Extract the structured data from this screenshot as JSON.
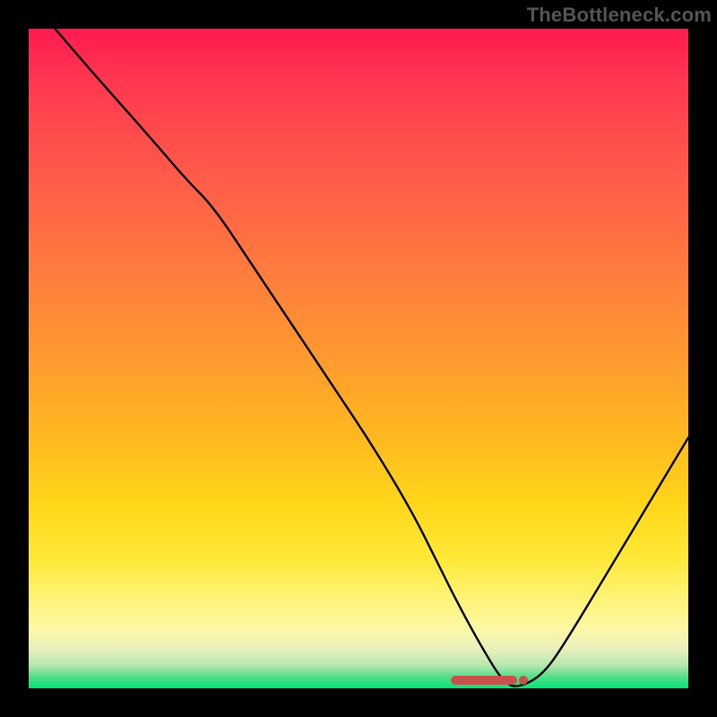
{
  "watermark": "TheBottleneck.com",
  "chart_data": {
    "type": "line",
    "title": "",
    "xlabel": "",
    "ylabel": "",
    "xlim": [
      0,
      100
    ],
    "ylim": [
      0,
      100
    ],
    "grid": false,
    "legend": false,
    "series": [
      {
        "name": "bottleneck-curve",
        "x": [
          4,
          10,
          18,
          24,
          28,
          34,
          40,
          46,
          52,
          58,
          62,
          66,
          70,
          72,
          74,
          78,
          82,
          88,
          94,
          100
        ],
        "values": [
          100,
          93,
          84,
          77,
          73,
          64,
          55,
          46,
          37,
          27,
          19,
          11,
          4,
          1,
          0,
          2,
          8,
          18,
          28,
          38
        ]
      }
    ],
    "optimum_range_x": [
      64,
      74
    ],
    "gradient_stops": [
      {
        "pos": 0,
        "color": "#ff1a52"
      },
      {
        "pos": 0.5,
        "color": "#ff9a30"
      },
      {
        "pos": 0.8,
        "color": "#ffe835"
      },
      {
        "pos": 1.0,
        "color": "#00e676"
      }
    ]
  }
}
